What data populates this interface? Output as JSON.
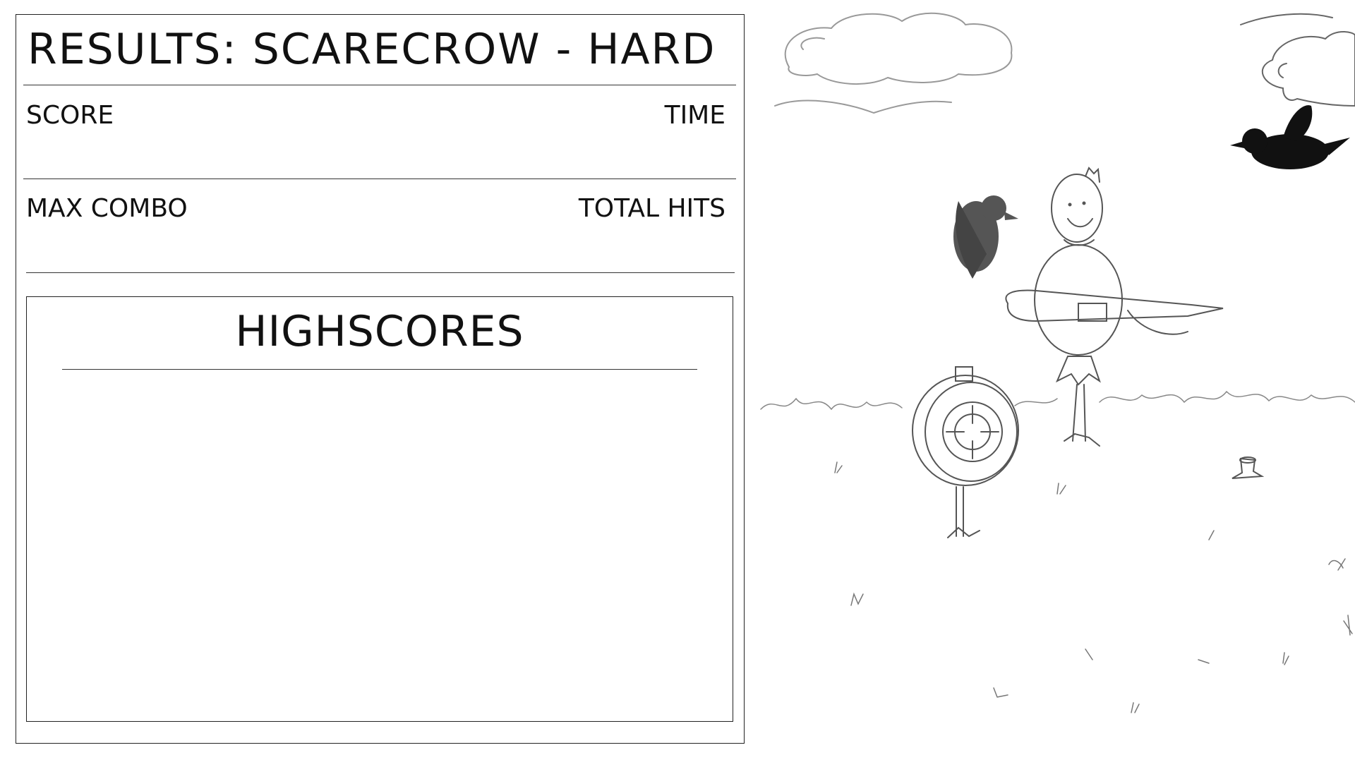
{
  "results": {
    "title": "RESULTS: SCARECROW - HARD",
    "score_label": "SCORE",
    "time_label": "TIME",
    "max_combo_label": "MAX COMBO",
    "total_hits_label": "TOTAL HITS",
    "score_value": "",
    "time_value": "",
    "max_combo_value": "",
    "total_hits_value": ""
  },
  "highscores": {
    "title": "HIGHSCORES",
    "entries": []
  },
  "scene": {
    "objects": [
      "cloud-left",
      "cloud-right",
      "crow-flying",
      "crow-perched",
      "scarecrow",
      "sword",
      "target-board",
      "tree-stump",
      "grass-line"
    ]
  },
  "colors": {
    "ink": "#111111",
    "line": "#333333",
    "background": "#ffffff"
  }
}
